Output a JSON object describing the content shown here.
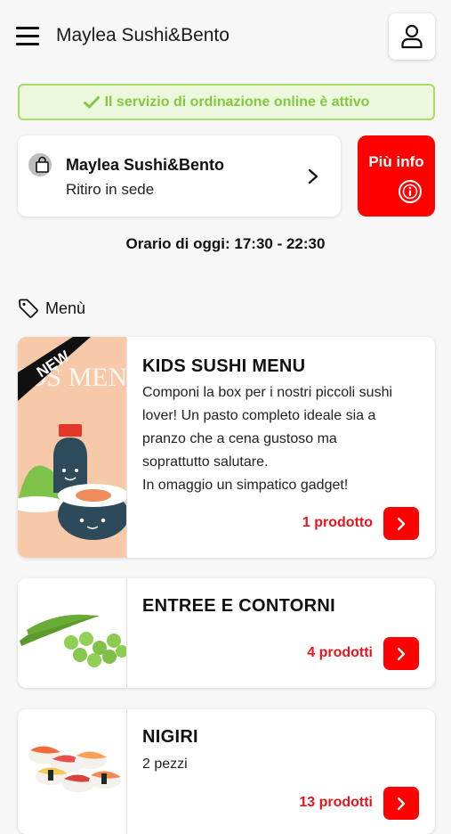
{
  "header": {
    "menu_icon": "hamburger-icon",
    "title": "Maylea Sushi&Bento",
    "user_icon": "user-icon"
  },
  "banner": {
    "text": "Il servizio di ordinazione online è attivo",
    "icon": "check-icon",
    "color": "#84c740"
  },
  "store": {
    "icon": "shopping-bag-icon",
    "name": "Maylea Sushi&Bento",
    "mode": "Ritiro in sede"
  },
  "info_button": {
    "label": "Più info",
    "icon": "info-icon",
    "color": "#ff0000"
  },
  "hours": "Orario di oggi: 17:30 - 22:30",
  "menu_heading": "Menù",
  "categories": [
    {
      "title": "KIDS SUSHI MENU",
      "description": "Componi la box per i nostri piccoli sushi\nlover! Un pasto completo ideale sia a\npranzo che a cena gustoso ma\nsoprattutto salutare.\nIn omaggio un simpatico gadget!",
      "count": "1 prodotto",
      "badge": "NEW",
      "image_text": "KIDS MENU"
    },
    {
      "title": "ENTREE E CONTORNI",
      "description": "",
      "count": "4 prodotti"
    },
    {
      "title": "NIGIRI",
      "description": "2 pezzi",
      "count": "13 prodotti"
    }
  ],
  "accent_color": "#ff0000"
}
